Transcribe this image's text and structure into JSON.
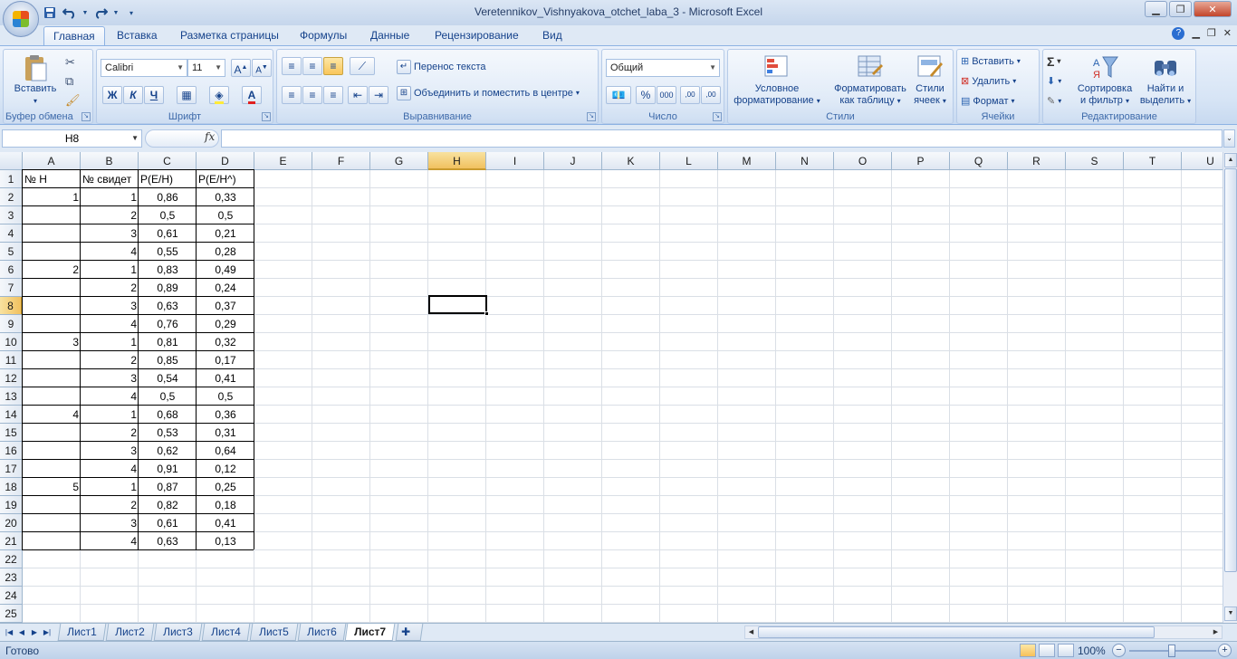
{
  "window": {
    "title": "Veretennikov_Vishnyakova_otchet_laba_3 - Microsoft Excel"
  },
  "qat": {
    "save_icon": "save-icon",
    "undo_icon": "undo-icon",
    "redo_icon": "redo-icon"
  },
  "tabs": [
    {
      "label": "Главная",
      "active": true
    },
    {
      "label": "Вставка"
    },
    {
      "label": "Разметка страницы"
    },
    {
      "label": "Формулы"
    },
    {
      "label": "Данные"
    },
    {
      "label": "Рецензирование"
    },
    {
      "label": "Вид"
    }
  ],
  "ribbon": {
    "clipboard": {
      "label": "Буфер обмена",
      "paste": "Вставить"
    },
    "font": {
      "label": "Шрифт",
      "font_name": "Calibri",
      "font_size": "11",
      "bold": "Ж",
      "italic": "К",
      "underline": "Ч"
    },
    "alignment": {
      "label": "Выравнивание",
      "wrap": "Перенос текста",
      "merge": "Объединить и поместить в центре"
    },
    "number": {
      "label": "Число",
      "format": "Общий",
      "percent": "%",
      "thousands": "000",
      "inc_decimal": ",00",
      "dec_decimal": ",00"
    },
    "styles": {
      "label": "Стили",
      "conditional_1": "Условное",
      "conditional_2": "форматирование",
      "as_table_1": "Форматировать",
      "as_table_2": "как таблицу",
      "cell_styles_1": "Стили",
      "cell_styles_2": "ячеек"
    },
    "cells": {
      "label": "Ячейки",
      "insert": "Вставить",
      "delete": "Удалить",
      "format": "Формат"
    },
    "editing": {
      "label": "Редактирование",
      "sigma": "Σ",
      "sort_1": "Сортировка",
      "sort_2": "и фильтр",
      "find_1": "Найти и",
      "find_2": "выделить"
    }
  },
  "formula_bar": {
    "name_box": "H8",
    "fx": "fx",
    "value": ""
  },
  "grid": {
    "columns": [
      "A",
      "B",
      "C",
      "D",
      "E",
      "F",
      "G",
      "H",
      "I",
      "J",
      "K",
      "L",
      "M",
      "N",
      "O",
      "P",
      "Q",
      "R",
      "S",
      "T",
      "U"
    ],
    "selected_column": "H",
    "selected_row": 8,
    "rows": [
      1,
      2,
      3,
      4,
      5,
      6,
      7,
      8,
      9,
      10,
      11,
      12,
      13,
      14,
      15,
      16,
      17,
      18,
      19,
      20,
      21,
      22,
      23,
      24,
      25
    ],
    "headers": {
      "a1": "№ H",
      "b1": "№ свидет",
      "c1": "P(E/H)",
      "d1": "P(E/H^)"
    },
    "data": [
      {
        "a": "1",
        "b": "1",
        "c": "0,86",
        "d": "0,33"
      },
      {
        "a": "",
        "b": "2",
        "c": "0,5",
        "d": "0,5"
      },
      {
        "a": "",
        "b": "3",
        "c": "0,61",
        "d": "0,21"
      },
      {
        "a": "",
        "b": "4",
        "c": "0,55",
        "d": "0,28"
      },
      {
        "a": "2",
        "b": "1",
        "c": "0,83",
        "d": "0,49"
      },
      {
        "a": "",
        "b": "2",
        "c": "0,89",
        "d": "0,24"
      },
      {
        "a": "",
        "b": "3",
        "c": "0,63",
        "d": "0,37"
      },
      {
        "a": "",
        "b": "4",
        "c": "0,76",
        "d": "0,29"
      },
      {
        "a": "3",
        "b": "1",
        "c": "0,81",
        "d": "0,32"
      },
      {
        "a": "",
        "b": "2",
        "c": "0,85",
        "d": "0,17"
      },
      {
        "a": "",
        "b": "3",
        "c": "0,54",
        "d": "0,41"
      },
      {
        "a": "",
        "b": "4",
        "c": "0,5",
        "d": "0,5"
      },
      {
        "a": "4",
        "b": "1",
        "c": "0,68",
        "d": "0,36"
      },
      {
        "a": "",
        "b": "2",
        "c": "0,53",
        "d": "0,31"
      },
      {
        "a": "",
        "b": "3",
        "c": "0,62",
        "d": "0,64"
      },
      {
        "a": "",
        "b": "4",
        "c": "0,91",
        "d": "0,12"
      },
      {
        "a": "5",
        "b": "1",
        "c": "0,87",
        "d": "0,25"
      },
      {
        "a": "",
        "b": "2",
        "c": "0,82",
        "d": "0,18"
      },
      {
        "a": "",
        "b": "3",
        "c": "0,61",
        "d": "0,41"
      },
      {
        "a": "",
        "b": "4",
        "c": "0,63",
        "d": "0,13"
      }
    ]
  },
  "sheets": [
    {
      "label": "Лист1"
    },
    {
      "label": "Лист2"
    },
    {
      "label": "Лист3"
    },
    {
      "label": "Лист4"
    },
    {
      "label": "Лист5"
    },
    {
      "label": "Лист6"
    },
    {
      "label": "Лист7",
      "active": true
    }
  ],
  "status": {
    "text": "Готово",
    "zoom": "100%"
  }
}
